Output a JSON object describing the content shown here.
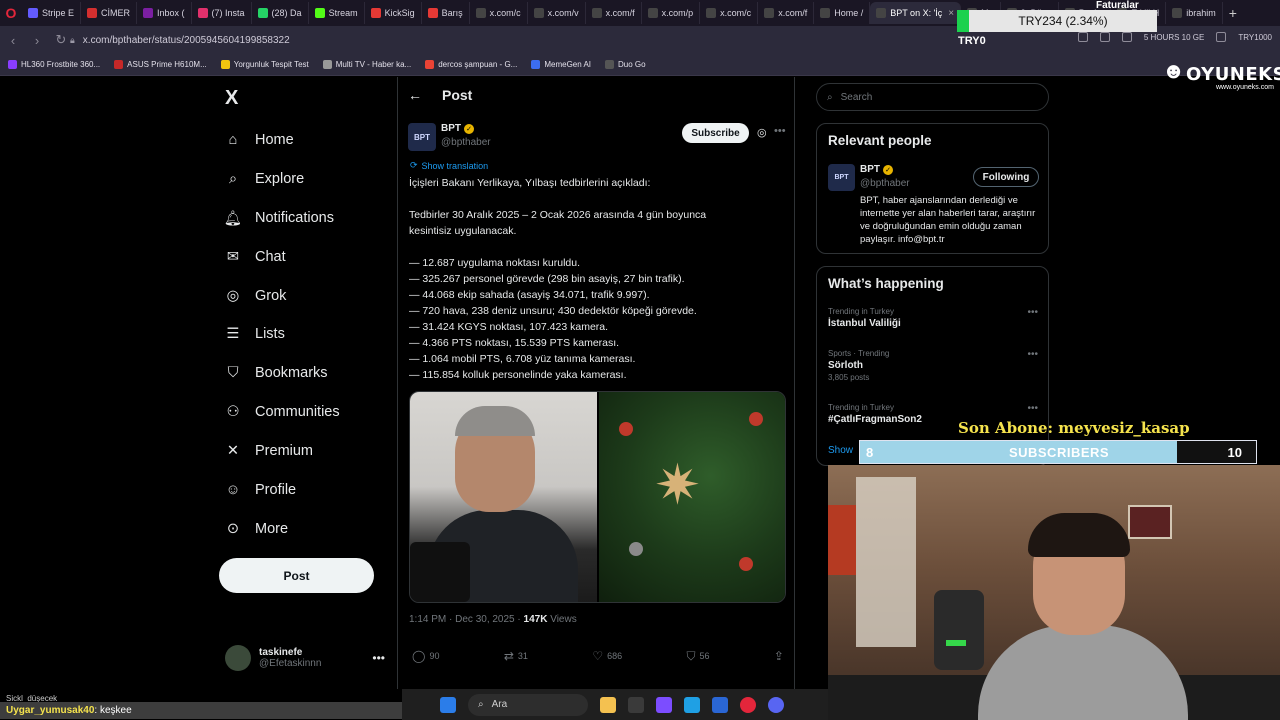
{
  "browser": {
    "tabs": [
      {
        "label": "Stripe E",
        "color": "#635bff"
      },
      {
        "label": "CİMER",
        "color": "#d32f2f"
      },
      {
        "label": "Inbox (",
        "color": "#7b1fa2"
      },
      {
        "label": "(7) Insta",
        "color": "#e1306c"
      },
      {
        "label": "(28) Da",
        "color": "#25d366"
      },
      {
        "label": "Stream",
        "color": "#53fc18"
      },
      {
        "label": "KickSig",
        "color": "#e53935"
      },
      {
        "label": "Barış",
        "color": "#e53935"
      },
      {
        "label": "x.com/c",
        "color": "#444444"
      },
      {
        "label": "x.com/v",
        "color": "#444444"
      },
      {
        "label": "x.com/f",
        "color": "#444444"
      },
      {
        "label": "x.com/p",
        "color": "#444444"
      },
      {
        "label": "x.com/c",
        "color": "#444444"
      },
      {
        "label": "x.com/f",
        "color": "#444444"
      },
      {
        "label": "Home /",
        "color": "#444444"
      },
      {
        "label": "BPT on X: 'İç",
        "color": "#444444",
        "active": true
      },
      {
        "label": "Mu",
        "color": "#444444"
      },
      {
        "label": "3. Düny",
        "color": "#444444"
      },
      {
        "label": "Pusho",
        "color": "#444444"
      },
      {
        "label": "Etkili H",
        "color": "#444444"
      },
      {
        "label": "ibrahim",
        "color": "#444444"
      }
    ],
    "url": "x.com/bpthaber/status/2005945604199858322",
    "timer_text": "5 HOURS 10 GE",
    "right_text": "TRY1000",
    "bookmarks": [
      "HL360 Frostbite 360...",
      "ASUS Prime H610M...",
      "Yorgunluk Tespit Test",
      "Multi TV - Haber ka...",
      "dercos şampuan - G...",
      "MemeGen AI",
      "Duo Go"
    ]
  },
  "nav": {
    "logo": "X",
    "items": [
      {
        "label": "Home",
        "icon": "home-icon"
      },
      {
        "label": "Explore",
        "icon": "search-icon"
      },
      {
        "label": "Notifications",
        "icon": "bell-icon"
      },
      {
        "label": "Chat",
        "icon": "mail-icon"
      },
      {
        "label": "Grok",
        "icon": "grok-icon"
      },
      {
        "label": "Lists",
        "icon": "lists-icon"
      },
      {
        "label": "Bookmarks",
        "icon": "bookmark-icon"
      },
      {
        "label": "Communities",
        "icon": "communities-icon"
      },
      {
        "label": "Premium",
        "icon": "x-icon"
      },
      {
        "label": "Profile",
        "icon": "person-icon"
      },
      {
        "label": "More",
        "icon": "more-circle-icon"
      }
    ],
    "post_button": "Post",
    "account": {
      "name": "taskinefe",
      "handle": "@Efetaskinnn"
    }
  },
  "post": {
    "header_title": "Post",
    "author": {
      "name": "BPT",
      "handle": "@bpthaber",
      "avatar_text": "BPT"
    },
    "subscribe_label": "Subscribe",
    "show_translation": "Show translation",
    "text": {
      "line1": "İçişleri Bakanı Yerlikaya, Yılbaşı tedbirlerini açıkladı:",
      "line2": "Tedbirler 30 Aralık 2025 – 2 Ocak 2026 arasında 4 gün boyunca",
      "line3": "kesintisiz uygulanacak.",
      "bullets": [
        "— 12.687 uygulama noktası kuruldu.",
        "— 325.267 personel görevde (298 bin asayiş, 27 bin trafik).",
        "— 44.068 ekip sahada (asayiş 34.071, trafik 9.997).",
        "— 720 hava, 238 deniz unsuru; 430 dedektör köpeği görevde.",
        "— 31.424 KGYS noktası, 107.423 kamera.",
        "— 4.366 PTS noktası, 15.539 PTS kamerası.",
        "— 1.064 mobil PTS, 6.708 yüz tanıma kamerası.",
        "— 115.854 kolluk personelinde yaka kamerası."
      ]
    },
    "timestamp": "1:14 PM · Dec 30, 2025 · ",
    "views_count": "147K",
    "views_label": " Views",
    "actions": {
      "replies": "90",
      "reposts": "31",
      "likes": "686",
      "bookmarks": "56"
    }
  },
  "sidebar": {
    "search_placeholder": "Search",
    "relevant_title": "Relevant people",
    "relevant": {
      "name": "BPT",
      "handle": "@bpthaber",
      "avatar_text": "BPT",
      "button": "Following",
      "bio": "BPT, haber ajanslarından derlediği ve internette yer alan haberleri tarar, araştırır ve doğruluğundan emin olduğu zaman paylaşır. info@bpt.tr"
    },
    "whats_title": "What’s happening",
    "trends": [
      {
        "context": "Trending in Turkey",
        "name": "İstanbul Valiliği",
        "posts": ""
      },
      {
        "context": "Sports · Trending",
        "name": "Sörloth",
        "posts": "3,805 posts"
      },
      {
        "context": "Trending in Turkey",
        "name": "#ÇatlıFragmanSon2",
        "posts": ""
      }
    ],
    "show_more": "Show"
  },
  "overlay": {
    "brand": "OYUNEKS",
    "brand_url": "www.oyuneks.com",
    "price": "TRY234 (2.34%)",
    "faturalar": "Faturalar",
    "try0": "TRY0",
    "son_abone": "Son Abone: meyvesiz_kasap",
    "subs_current": "8",
    "subs_label": "SUBSCRIBERS",
    "subs_goal": "10",
    "subs_progress": 0.8
  },
  "chat": {
    "line1": "Sickl_düşecek",
    "user": "Uygar_yumusak40",
    "message": ": keşkee"
  },
  "taskbar": {
    "search_placeholder": "Ara"
  },
  "colors": {
    "accent_blue": "#1d9bf0",
    "verified_gold": "#e8b400",
    "price_green": "#1bd14e",
    "overlay_yellow": "#f5e34d"
  }
}
